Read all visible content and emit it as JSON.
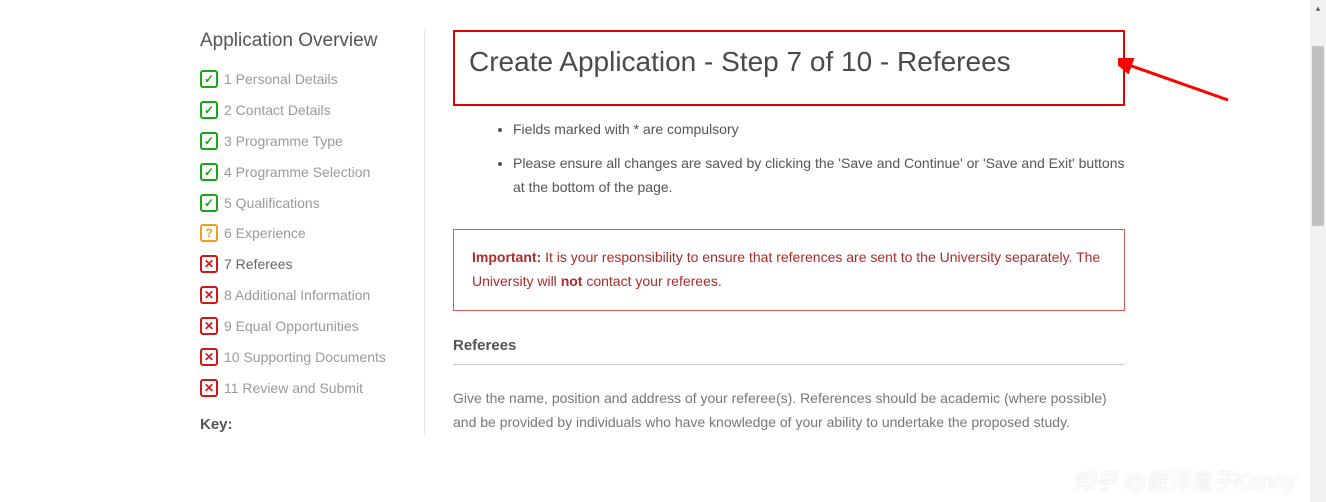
{
  "sidebar": {
    "heading": "Application Overview",
    "items": [
      {
        "num": "1",
        "label": "Personal Details",
        "status": "done"
      },
      {
        "num": "2",
        "label": "Contact Details",
        "status": "done"
      },
      {
        "num": "3",
        "label": "Programme Type",
        "status": "done"
      },
      {
        "num": "4",
        "label": "Programme Selection",
        "status": "done"
      },
      {
        "num": "5",
        "label": "Qualifications",
        "status": "done"
      },
      {
        "num": "6",
        "label": "Experience",
        "status": "warn"
      },
      {
        "num": "7",
        "label": "Referees",
        "status": "err",
        "current": true
      },
      {
        "num": "8",
        "label": "Additional Information",
        "status": "err"
      },
      {
        "num": "9",
        "label": "Equal Opportunities",
        "status": "err"
      },
      {
        "num": "10",
        "label": "Supporting Documents",
        "status": "err"
      },
      {
        "num": "11",
        "label": "Review and Submit",
        "status": "err"
      }
    ],
    "key_label": "Key:"
  },
  "main": {
    "title": "Create Application - Step 7 of 10 - Referees",
    "instructions": [
      "Fields marked with * are compulsory",
      "Please ensure all changes are saved by clicking the 'Save and Continue' or 'Save and Exit' buttons at the bottom of the page."
    ],
    "important_label": "Important:",
    "important_text_1": " It is your responsibility to ensure that references are sent to the University separately. The University will ",
    "important_bold": "not",
    "important_text_2": " contact your referees.",
    "section_heading": "Referees",
    "section_text": "Give the name, position and address of your referee(s). References should be academic (where possible) and be provided by individuals who have knowledge of your ability to undertake the proposed study."
  },
  "watermark": "知乎 @假洋鬼子Kenny",
  "icons": {
    "done_glyph": "✓",
    "warn_glyph": "?",
    "err_glyph": "✕",
    "scroll_up_glyph": "▴"
  }
}
